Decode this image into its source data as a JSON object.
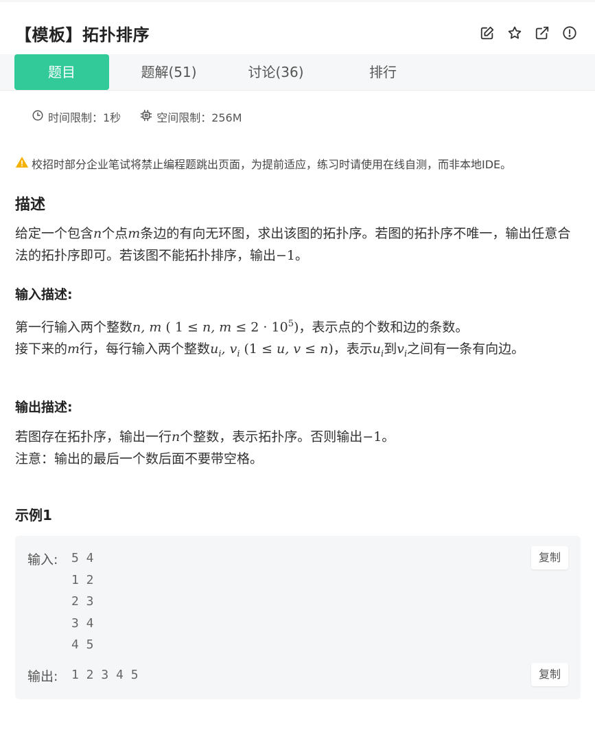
{
  "problem": {
    "title": "【模板】拓扑排序"
  },
  "header_icons": [
    "edit-icon",
    "star-icon",
    "external-link-icon",
    "report-icon"
  ],
  "tabs": [
    {
      "label": "题目",
      "active": true
    },
    {
      "label": "题解(51)",
      "active": false
    },
    {
      "label": "讨论(36)",
      "active": false
    },
    {
      "label": "排行",
      "active": false
    }
  ],
  "limits": {
    "time": "时间限制：1秒",
    "space": "空间限制：256M"
  },
  "warning": "校招时部分企业笔试将禁止编程题跳出页面，为提前适应，练习时请使用在线自测，而非本地IDE。",
  "description": {
    "heading": "描述",
    "t1": "给定一个包含",
    "m_n": "n",
    "t2": "个点",
    "m_m": "m",
    "t3": "条边的有向无环图，求出该图的拓扑序。若图的拓扑序不唯一，输出任意合法的拓扑序即可。若该图不能拓扑排序，输出",
    "m_neg": "−1",
    "t4": "。"
  },
  "input_desc": {
    "heading": "输入描述:",
    "l1_a": "第一行输入两个整数",
    "l1_math1": "n, m",
    "l1_math2": " ( 1 ≤ ",
    "l1_math3": "n, m",
    "l1_math4": " ≤ 2 · 10",
    "l1_sup": "5",
    "l1_math5": ")",
    "l1_b": "，表示点的个数和边的条数。",
    "l2_a": "接下来的",
    "l2_m": "m",
    "l2_b": "行，每行输入两个整数",
    "l2_u": "u",
    "l2_i1": "i",
    "l2_comma": ", ",
    "l2_v": "v",
    "l2_i2": "i",
    "l2_math1": " (1 ≤ ",
    "l2_math2": "u, v",
    "l2_math3": " ≤ ",
    "l2_math4": "n",
    "l2_math5": ")",
    "l2_c": "，表示",
    "l2_u2": "u",
    "l2_i3": "i",
    "l2_d": "到",
    "l2_v2": "v",
    "l2_i4": "i",
    "l2_e": "之间有一条有向边。"
  },
  "output_desc": {
    "heading": "输出描述:",
    "l1_a": "若图存在拓扑序，输出一行",
    "l1_n": "n",
    "l1_b": "个整数，表示拓扑序。否则输出",
    "l1_neg": "−1",
    "l1_c": "。",
    "l2": "注意：输出的最后一个数后面不要带空格。"
  },
  "example": {
    "heading": "示例1",
    "input_label": "输入:",
    "input_value": "5 4\n1 2\n2 3\n3 4\n4 5",
    "output_label": "输出:",
    "output_value": "1 2 3 4 5",
    "copy_label": "复制"
  },
  "colors": {
    "accent": "#32ca99",
    "warning": "#f5b100"
  }
}
